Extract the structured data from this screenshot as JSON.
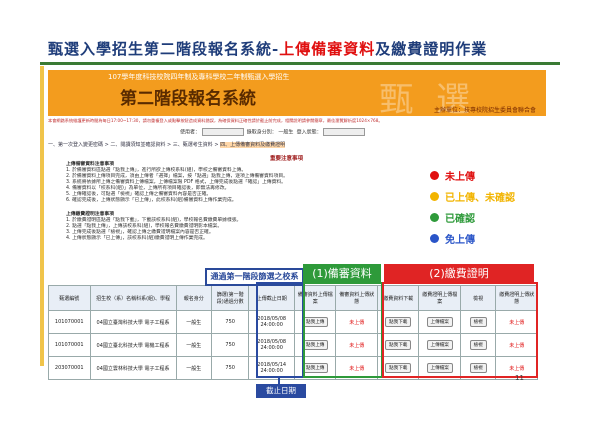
{
  "slide": {
    "title_prefix": "甄選入學招生第二階段報名系統-",
    "title_highlight": "上傳備審資料",
    "title_suffix": "及繳費證明作業",
    "page_number": "11"
  },
  "banner": {
    "subtitle": "107學年度科技校院四年制及專科學校二年制甄選入學招生",
    "main_title": "第二階段報名系統",
    "ghost_text": "甄 選",
    "organizer": "主辦單位：技專校院招生委員會聯合會"
  },
  "notice_line": "本會網路系統維護更新時間為每日17:00~17:30，請勿重複登入或點擊按鈕造成資料錯誤，為確保資料正確性請於截止前完成，相關說明請參閱簡章，最佳瀏覽解析度1024×768。",
  "user_row": {
    "id_label": "使用者：",
    "group_label": "錄取身分別：",
    "group_value": "一般生",
    "login_label": "登入狀態："
  },
  "steps": [
    "一、第一次登入變更密碼",
    "二、閱讀須知並確認資料",
    "三、甄選考生資料",
    "四、上傳備審資料及繳費證明"
  ],
  "notice_heading": "重要注意事項",
  "rules_review": {
    "heading": "上傳備審資料注意事項",
    "items": [
      "1. 於備審資料區點選「點我上傳」，進行所欲上傳校系科(組)，學校之備審資料上傳。",
      "2. 於備審資料上傳項目完成，須由上傳者「選擇」檔案，按「點選」點我上傳，逐項上傳備審資料項目。",
      "3. 系統將依據所上傳之備審資料上傳檔案，上傳檔案限 PDF 格式，上傳完成後點選「確認」上傳資料。",
      "4. 備審資料以「校系科(組)」為單位，上傳所有項目確認後，即無法再修改。",
      "5. 上傳確認後，可點選「檢視」確認上傳之備審資料內容是否正確。",
      "6. 確認完成後，上傳狀態顯示「已上傳」，此校系科(組)備審資料上傳作業完成。"
    ]
  },
  "rules_payment": {
    "heading": "上傳繳費證明注意事項",
    "items": [
      "1. 於繳費證明區點選「點我下載」，下載該校系科(組)，學校報名費繳費單據樣張。",
      "2. 點選「點我上傳」，上傳該校系科(組)，學校報名費繳費證明影本檔案。",
      "3. 上傳完成後點選「檢視」，確認上傳之繳費證明檔案內容是否正確。",
      "4. 上傳狀態顯示「已上傳」，該校系科(組)繳費證明上傳作業完成。"
    ]
  },
  "legend": [
    {
      "label": "未上傳",
      "color": "#e01010"
    },
    {
      "label": "已上傳、未確認",
      "color": "#f2b400"
    },
    {
      "label": "已確認",
      "color": "#2e9a3a"
    },
    {
      "label": "免上傳",
      "color": "#2a55c8"
    }
  ],
  "overlays": {
    "pass_label": "通過第一階段篩選之校系",
    "review_label": "(1)備審資料",
    "payment_label": "(2)繳費證明",
    "deadline_label": "截止日期"
  },
  "table": {
    "headers": [
      "甄選編號",
      "招生校（系）名稱科系(組)、學程",
      "報名身分",
      "篩選(第一階段)通過分數",
      "上傳截止日期",
      "備審資料上傳檔案",
      "備審資料上傳狀態",
      "繳費資料下載",
      "繳費證明上傳檔案",
      "檢視",
      "繳費證明上傳狀態"
    ],
    "rows": [
      {
        "id": "101070001",
        "school": "04國立臺灣科技大學 電子工程系",
        "status": "一般生",
        "score": "750",
        "deadline": "2018/05/08 24:00:00",
        "review_btn": "點我上傳",
        "review_state": "未上傳",
        "dl_btn": "點我下載",
        "up_btn": "上傳檔案",
        "view_btn": "檢視",
        "pay_state": "未上傳"
      },
      {
        "id": "101070001",
        "school": "04國立臺北科技大學 電機工程系",
        "status": "一般生",
        "score": "750",
        "deadline": "2018/05/08 24:00:00",
        "review_btn": "點我上傳",
        "review_state": "未上傳",
        "dl_btn": "點我下載",
        "up_btn": "上傳檔案",
        "view_btn": "檢視",
        "pay_state": "未上傳"
      },
      {
        "id": "203070001",
        "school": "04國立雲林科技大學 電子工程系",
        "status": "一般生",
        "score": "750",
        "deadline": "2018/05/14 24:00:00",
        "review_btn": "點我上傳",
        "review_state": "未上傳",
        "dl_btn": "點我下載",
        "up_btn": "上傳檔案",
        "view_btn": "檢視",
        "pay_state": "未上傳"
      }
    ]
  }
}
